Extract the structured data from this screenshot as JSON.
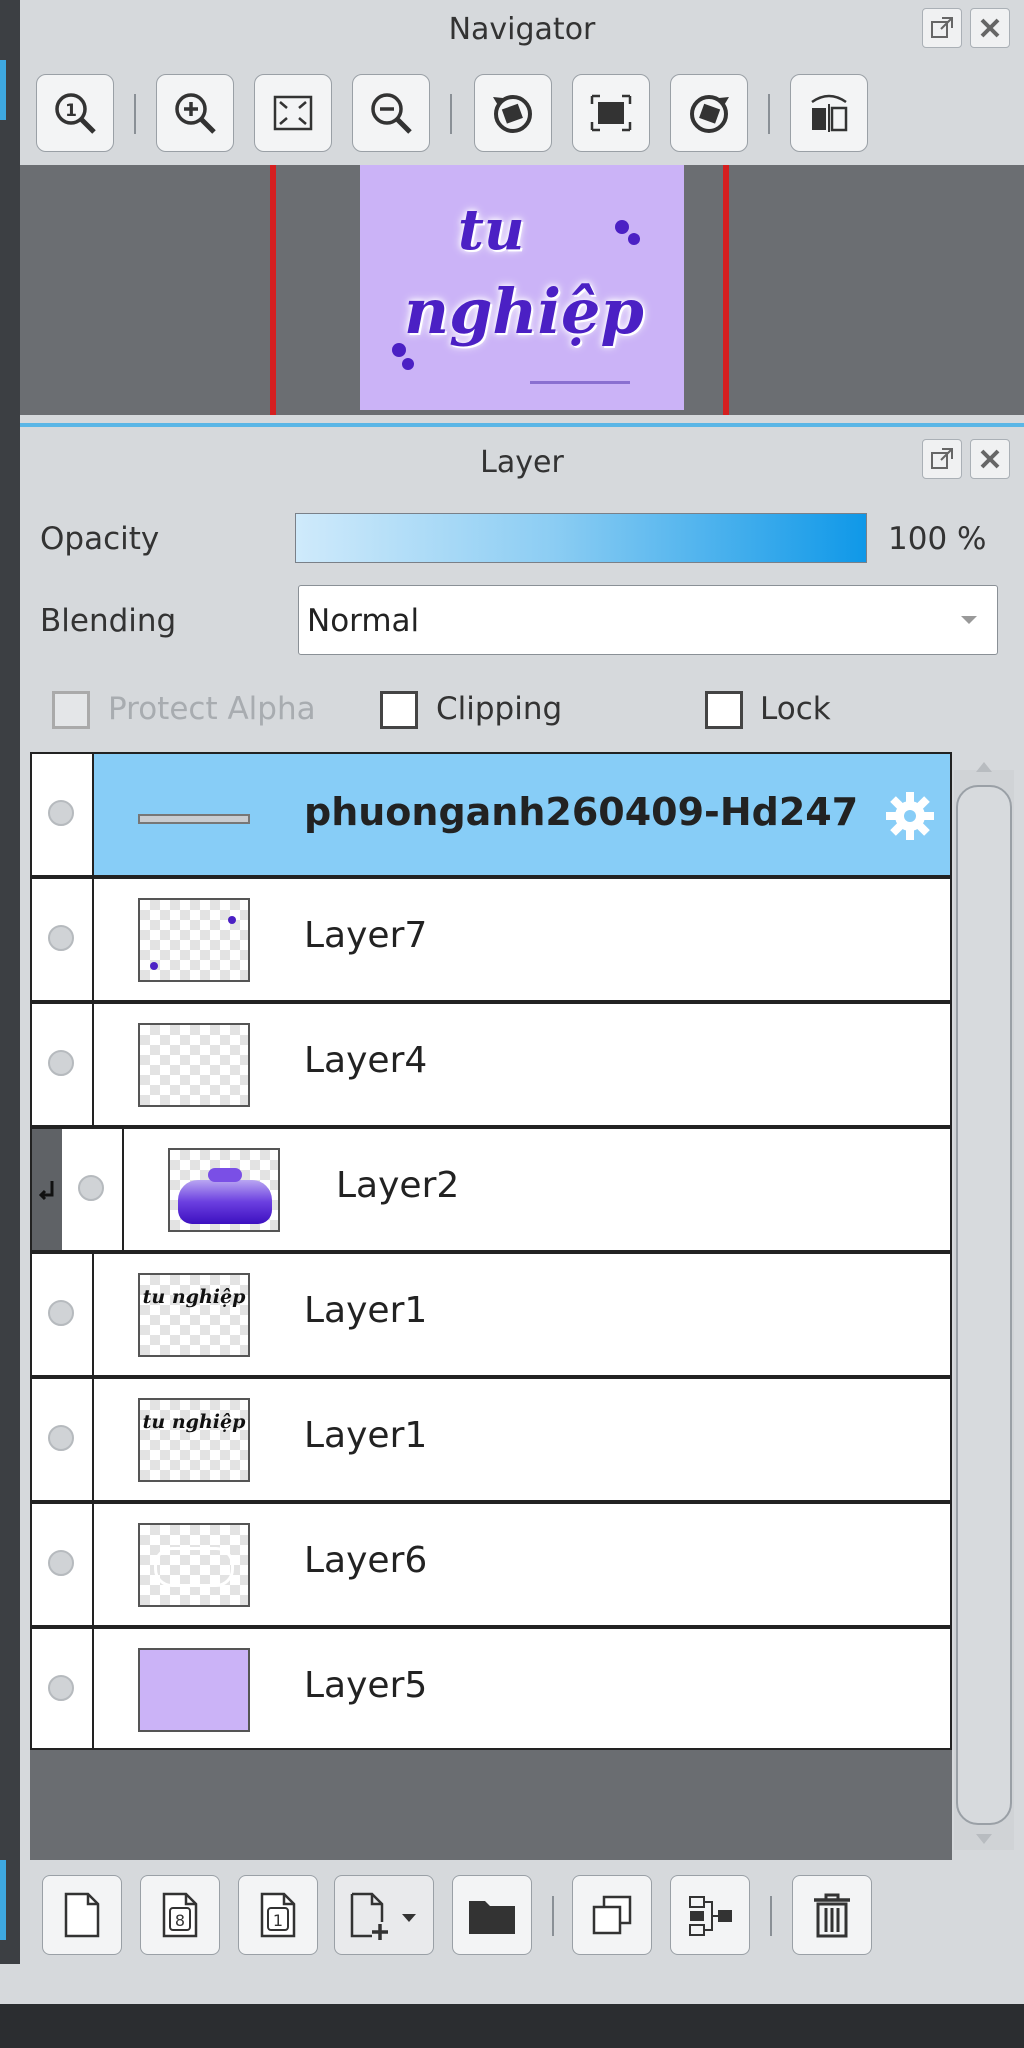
{
  "navigator": {
    "title": "Navigator",
    "tools": [
      {
        "icon": "actual-size-icon"
      },
      {
        "icon": "zoom-in-icon"
      },
      {
        "icon": "fit-window-icon"
      },
      {
        "icon": "zoom-out-icon"
      },
      {
        "icon": "rotate-left-icon"
      },
      {
        "icon": "reset-view-icon"
      },
      {
        "icon": "rotate-right-icon"
      },
      {
        "icon": "flip-horizontal-icon"
      }
    ],
    "preview": {
      "line1": "tu",
      "line2": "nghiệp",
      "bg_color": "#cbb3f7",
      "text_color": "#4b20c4"
    }
  },
  "layer_panel": {
    "title": "Layer",
    "opacity_label": "Opacity",
    "opacity_value": "100 %",
    "opacity_level": 1.0,
    "blending_label": "Blending",
    "blending_value": "Normal",
    "protect_alpha_label": "Protect Alpha",
    "clipping_label": "Clipping",
    "lock_label": "Lock",
    "layers": [
      {
        "name": "phuonganh260409-Hd247",
        "selected": true,
        "type": "folder"
      },
      {
        "name": "Layer7"
      },
      {
        "name": "Layer4"
      },
      {
        "name": "Layer2",
        "clipped": true
      },
      {
        "name": "Layer1",
        "thumb_text": "tu nghiệp"
      },
      {
        "name": "Layer1",
        "thumb_text": "tu nghiệp"
      },
      {
        "name": "Layer6"
      },
      {
        "name": "Layer5",
        "thumb_color": "#cbb3f7"
      }
    ],
    "bottom_tools": [
      {
        "icon": "new-layer-icon"
      },
      {
        "icon": "new-8bit-layer-icon",
        "glyph": "8"
      },
      {
        "icon": "new-1bit-layer-icon",
        "glyph": "1"
      },
      {
        "icon": "add-layer-menu-icon"
      },
      {
        "icon": "new-folder-icon"
      },
      {
        "icon": "duplicate-layer-icon"
      },
      {
        "icon": "merge-down-icon"
      },
      {
        "icon": "delete-layer-icon"
      }
    ]
  },
  "colors": {
    "selection": "#87cdf7",
    "accent": "#0f98e8",
    "panel_bg": "#d6d9dc"
  }
}
